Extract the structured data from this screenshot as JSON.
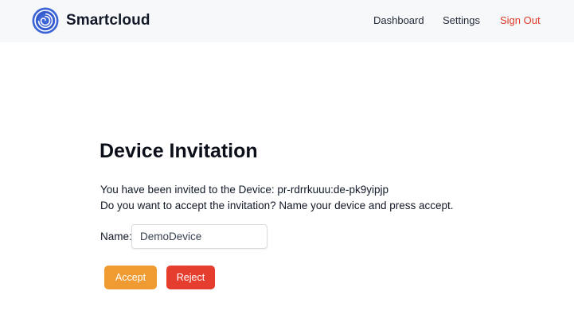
{
  "navbar": {
    "brand": "Smartcloud",
    "logo_icon": "smartcloud-spiral-logo",
    "links": {
      "dashboard": "Dashboard",
      "settings": "Settings",
      "sign_out": "Sign Out"
    },
    "sign_out_color": "#dc3b27"
  },
  "main": {
    "title": "Device Invitation",
    "message_line1": "You have been invited to the Device: pr-rdrrkuuu:de-pk9yipjp",
    "message_line2": "Do you want to accept the invitation? Name your device and press accept.",
    "name_label": "Name:",
    "name_value": "DemoDevice",
    "accept_label": "Accept",
    "reject_label": "Reject"
  },
  "colors": {
    "accept": "#f09a32",
    "reject": "#e53d2e",
    "brand_blue": "#3b63d6"
  }
}
